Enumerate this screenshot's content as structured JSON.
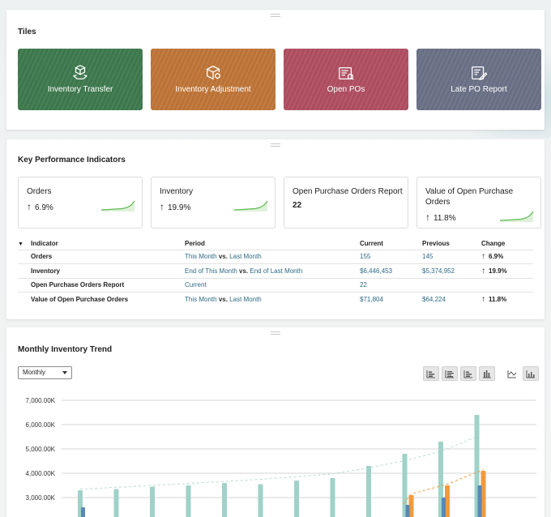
{
  "tiles_section": {
    "title": "Tiles",
    "tiles": [
      {
        "label": "Inventory Transfer",
        "color": "#3f7a4e",
        "icon": "boxes-transfer-icon"
      },
      {
        "label": "Inventory Adjustment",
        "color": "#c07638",
        "icon": "box-adjust-icon"
      },
      {
        "label": "Open POs",
        "color": "#b14f62",
        "icon": "document-list-icon"
      },
      {
        "label": "Late PO Report",
        "color": "#6b7287",
        "icon": "document-edit-icon"
      }
    ]
  },
  "kpi_section": {
    "title": "Key Performance Indicators",
    "cards": [
      {
        "name": "Orders",
        "value": "6.9%",
        "trend": "up"
      },
      {
        "name": "Inventory",
        "value": "19.9%",
        "trend": "up"
      },
      {
        "name": "Open Purchase Orders Report",
        "value": "22",
        "trend": "none"
      },
      {
        "name": "Value of Open Purchase Orders",
        "value": "11.8%",
        "trend": "up"
      }
    ],
    "table": {
      "headers": [
        "Indicator",
        "Period",
        "Current",
        "Previous",
        "Change"
      ],
      "rows": [
        {
          "indicator": "Orders",
          "period_a": "This Month",
          "period_vs": "vs.",
          "period_b": "Last Month",
          "current": "155",
          "previous": "145",
          "change": "6.9%"
        },
        {
          "indicator": "Inventory",
          "period_a": "End of This Month",
          "period_vs": "vs.",
          "period_b": "End of Last Month",
          "current": "$6,446,453",
          "previous": "$5,374,952",
          "change": "19.9%"
        },
        {
          "indicator": "Open Purchase Orders Report",
          "period_a": "Current",
          "period_vs": "",
          "period_b": "",
          "current": "22",
          "previous": "",
          "change": ""
        },
        {
          "indicator": "Value of Open Purchase Orders",
          "period_a": "This Month",
          "period_vs": "vs.",
          "period_b": "Last Month",
          "current": "$71,804",
          "previous": "$64,224",
          "change": "11.8%"
        }
      ]
    }
  },
  "trend_section": {
    "title": "Monthly Inventory Trend",
    "period_select": "Monthly",
    "chart_type_buttons": [
      "stacked-bar-icon",
      "grouped-bar-icon",
      "bar-icon",
      "column-icon",
      "line-icon",
      "combo-chart-icon"
    ]
  },
  "colors": {
    "teal_bar": "#9fd2c8",
    "teal_line": "#b7dcd3",
    "orange_bar": "#f09a3e",
    "blue_bar": "#5b87b6",
    "spark_green": "#5cba4f"
  },
  "chart_data": {
    "type": "bar",
    "ylabel": "",
    "xlabel": "",
    "y_ticks": [
      "7,000.00K",
      "6,000.00K",
      "5,000.00K",
      "4,000.00K",
      "3,000.00K"
    ],
    "ylim": [
      2500,
      7000
    ],
    "grid": true,
    "series": [
      {
        "values": [
          3300,
          3350,
          3450,
          3500,
          3600,
          3550,
          3700,
          3800,
          4300,
          4800,
          5300,
          6400
        ]
      },
      {
        "values": [
          null,
          null,
          null,
          null,
          null,
          null,
          null,
          null,
          null,
          3100,
          3500,
          4100
        ]
      },
      {
        "values": [
          2600,
          null,
          null,
          null,
          null,
          null,
          null,
          null,
          null,
          2700,
          3000,
          3500
        ]
      }
    ],
    "trend_line": [
      3350,
      3420,
      3500,
      3580,
      3660,
      3750,
      3860,
      3980,
      4220,
      4520,
      4900,
      5500
    ]
  }
}
